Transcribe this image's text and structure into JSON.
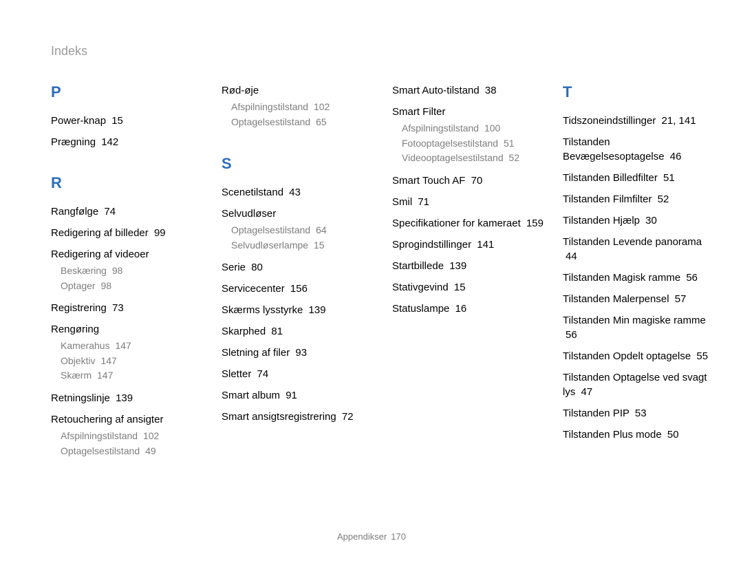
{
  "header": "Indeks",
  "footer": {
    "label": "Appendikser",
    "page": "170"
  },
  "col1": {
    "P": {
      "letter": "P",
      "items": [
        {
          "label": "Power-knap",
          "page": "15"
        },
        {
          "label": "Prægning",
          "page": "142"
        }
      ]
    },
    "R": {
      "letter": "R",
      "items": [
        {
          "label": "Rangfølge",
          "page": "74"
        },
        {
          "label": "Redigering af billeder",
          "page": "99"
        },
        {
          "label": "Redigering af videoer",
          "subs": [
            {
              "label": "Beskæring",
              "page": "98"
            },
            {
              "label": "Optager",
              "page": "98"
            }
          ]
        },
        {
          "label": "Registrering",
          "page": "73"
        },
        {
          "label": "Rengøring",
          "subs": [
            {
              "label": "Kamerahus",
              "page": "147"
            },
            {
              "label": "Objektiv",
              "page": "147"
            },
            {
              "label": "Skærm",
              "page": "147"
            }
          ]
        },
        {
          "label": "Retningslinje",
          "page": "139"
        },
        {
          "label": "Retouchering af ansigter",
          "subs": [
            {
              "label": "Afspilningstilstand",
              "page": "102"
            },
            {
              "label": "Optagelsestilstand",
              "page": "49"
            }
          ]
        }
      ]
    }
  },
  "col2": {
    "Rtop": [
      {
        "label": "Rød-øje",
        "subs": [
          {
            "label": "Afspilningstilstand",
            "page": "102"
          },
          {
            "label": "Optagelsestilstand",
            "page": "65"
          }
        ]
      }
    ],
    "S": {
      "letter": "S",
      "items": [
        {
          "label": "Scenetilstand",
          "page": "43"
        },
        {
          "label": "Selvudløser",
          "subs": [
            {
              "label": "Optagelsestilstand",
              "page": "64"
            },
            {
              "label": "Selvudløserlampe",
              "page": "15"
            }
          ]
        },
        {
          "label": "Serie",
          "page": "80"
        },
        {
          "label": "Servicecenter",
          "page": "156"
        },
        {
          "label": "Skærms lysstyrke",
          "page": "139"
        },
        {
          "label": "Skarphed",
          "page": "81"
        },
        {
          "label": "Sletning af filer",
          "page": "93"
        },
        {
          "label": "Sletter",
          "page": "74"
        },
        {
          "label": "Smart album",
          "page": "91"
        },
        {
          "label": "Smart ansigtsregistrering",
          "page": "72"
        }
      ]
    }
  },
  "col3": [
    {
      "label": "Smart Auto-tilstand",
      "page": "38"
    },
    {
      "label": "Smart Filter",
      "subs": [
        {
          "label": "Afspilningstilstand",
          "page": "100"
        },
        {
          "label": "Fotooptagelsestilstand",
          "page": "51"
        },
        {
          "label": "Videooptagelsestilstand",
          "page": "52"
        }
      ]
    },
    {
      "label": "Smart Touch AF",
      "page": "70"
    },
    {
      "label": "Smil",
      "page": "71"
    },
    {
      "label": "Specifikationer for kameraet",
      "page": "159"
    },
    {
      "label": "Sprogindstillinger",
      "page": "141"
    },
    {
      "label": "Startbillede",
      "page": "139"
    },
    {
      "label": "Stativgevind",
      "page": "15"
    },
    {
      "label": "Statuslampe",
      "page": "16"
    }
  ],
  "col4": {
    "T": {
      "letter": "T",
      "items": [
        {
          "label": "Tidszoneindstillinger",
          "page": "21, 141"
        },
        {
          "label": "Tilstanden Bevægelsesoptagelse",
          "page": "46"
        },
        {
          "label": "Tilstanden Billedfilter",
          "page": "51"
        },
        {
          "label": "Tilstanden Filmfilter",
          "page": "52"
        },
        {
          "label": "Tilstanden Hjælp",
          "page": "30"
        },
        {
          "label": "Tilstanden Levende panorama",
          "page": "44"
        },
        {
          "label": "Tilstanden Magisk ramme",
          "page": "56"
        },
        {
          "label": "Tilstanden Malerpensel",
          "page": "57"
        },
        {
          "label": "Tilstanden Min magiske ramme",
          "page": "56"
        },
        {
          "label": "Tilstanden Opdelt optagelse",
          "page": "55"
        },
        {
          "label": "Tilstanden Optagelse ved svagt lys",
          "page": "47"
        },
        {
          "label": "Tilstanden PIP",
          "page": "53"
        },
        {
          "label": "Tilstanden Plus mode",
          "page": "50"
        }
      ]
    }
  }
}
